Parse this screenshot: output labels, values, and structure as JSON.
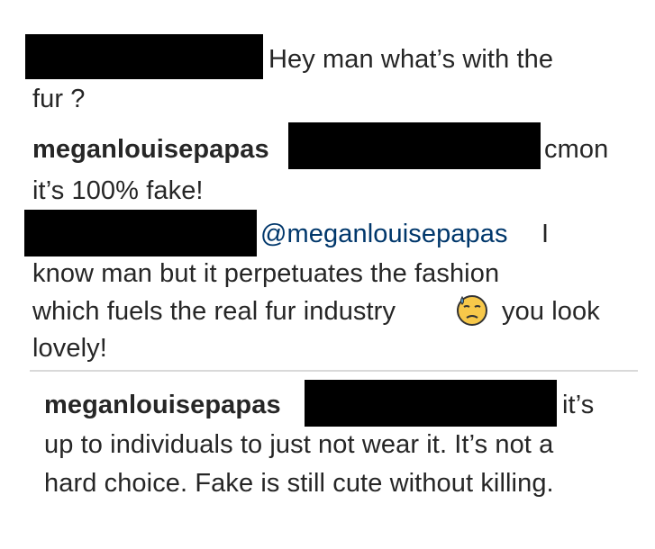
{
  "comments": [
    {
      "lines": [
        "Hey man what’s with the",
        "fur ?"
      ]
    },
    {
      "username": "meganlouisepapas",
      "lines": [
        "cmon",
        "it’s 100% fake!"
      ]
    },
    {
      "mention": "@meganlouisepapas",
      "lines": [
        "I",
        "know man but it perpetuates the fashion",
        "which fuels the real fur industry",
        "you look",
        "lovely!"
      ],
      "emoji": "downcast-face-with-sweat-icon"
    },
    {
      "username": "meganlouisepapas",
      "lines": [
        "it’s",
        "up to individuals to just not wear it. It’s not a",
        "hard choice. Fake is still cute without killing."
      ]
    }
  ],
  "colors": {
    "text": "#262626",
    "mention": "#00376b",
    "redaction": "#000000",
    "divider": "#d9d9d9"
  }
}
